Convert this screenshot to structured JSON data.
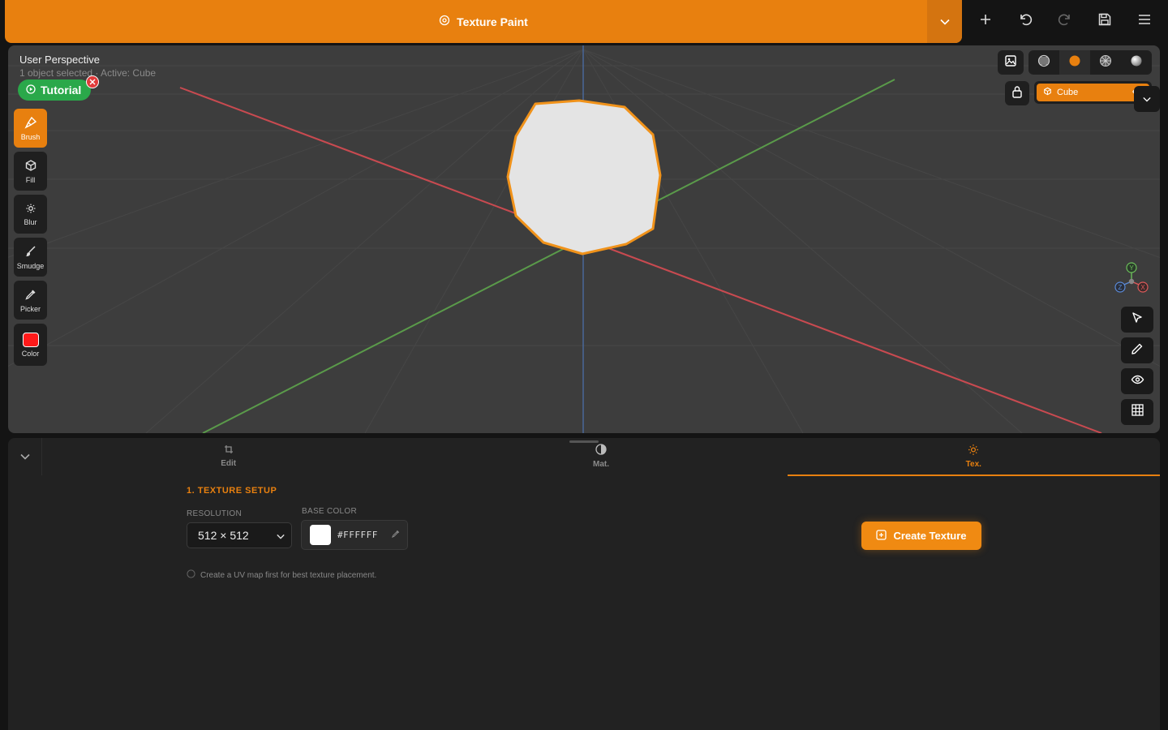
{
  "header": {
    "mode_title": "Texture Paint",
    "mode_icon": "target-icon",
    "actions": [
      {
        "name": "add-button",
        "icon": "plus-icon"
      },
      {
        "name": "undo-button",
        "icon": "undo-icon"
      },
      {
        "name": "redo-button",
        "icon": "redo-icon"
      },
      {
        "name": "save-button",
        "icon": "save-icon"
      },
      {
        "name": "menu-button",
        "icon": "hamburger-icon"
      }
    ]
  },
  "viewport": {
    "title": "User Perspective",
    "subtitle": "1 object selected · Active: Cube",
    "tutorial_label": "Tutorial",
    "tools": [
      {
        "label": "Brush",
        "icon": "brush-icon",
        "active": true
      },
      {
        "label": "Fill",
        "icon": "fill-cube-icon",
        "active": false
      },
      {
        "label": "Blur",
        "icon": "blur-icon",
        "active": false
      },
      {
        "label": "Smudge",
        "icon": "smudge-icon",
        "active": false
      },
      {
        "label": "Picker",
        "icon": "eyedropper-icon",
        "active": false
      },
      {
        "label": "Color",
        "icon": "color-swatch",
        "active": false
      }
    ],
    "brush_color": "#ff1a1a",
    "shading_modes": [
      "wireframe",
      "solid",
      "material",
      "rendered"
    ],
    "active_shading": "solid",
    "object": {
      "name": "Cube",
      "visible": true
    },
    "gizmo_axes": [
      "Y",
      "Z",
      "X"
    ],
    "side_tools": [
      "select-icon",
      "pencil-icon",
      "eye-icon",
      "grid-icon"
    ]
  },
  "panel": {
    "tabs": [
      {
        "label": "Edit",
        "icon": "crop-icon",
        "active": false
      },
      {
        "label": "Mat.",
        "icon": "contrast-icon",
        "active": false
      },
      {
        "label": "Tex.",
        "icon": "sun-icon",
        "active": true
      }
    ],
    "section_title": "1. TEXTURE SETUP",
    "resolution_label": "RESOLUTION",
    "resolution_value": "512 × 512",
    "base_color_label": "BASE COLOR",
    "base_color_hex": "#FFFFFF",
    "hint": "Create a UV map first for best texture placement.",
    "create_button": "Create Texture"
  },
  "colors": {
    "accent": "#e8800f",
    "tutorial": "#2aa84a",
    "axis_x": "#c84a50",
    "axis_y": "#5a9a4a",
    "axis_z": "#4a6aa0"
  }
}
